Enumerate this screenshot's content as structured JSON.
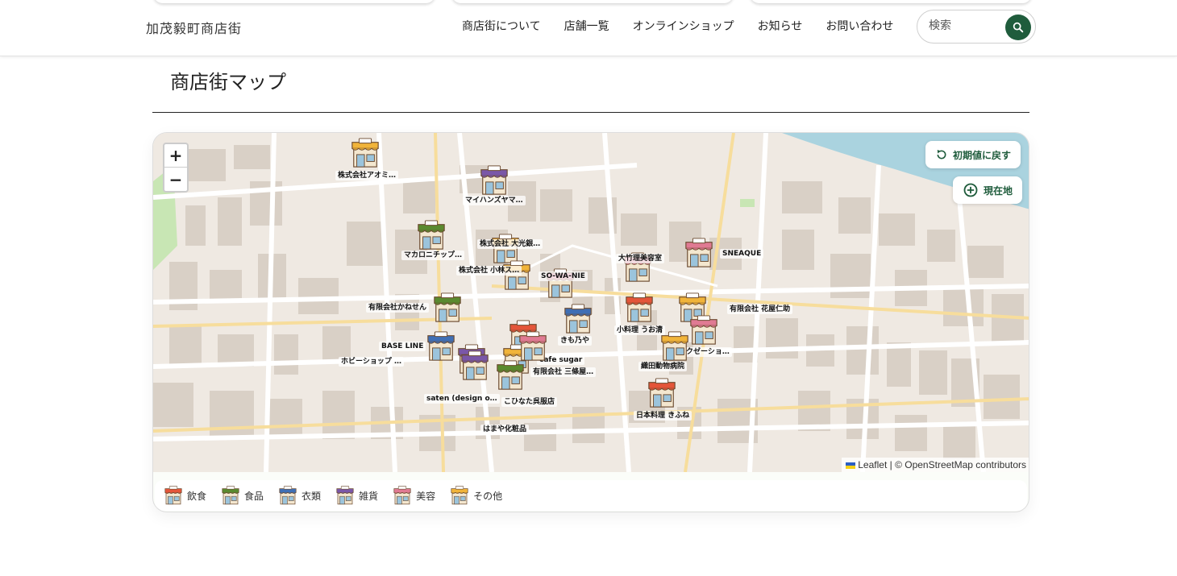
{
  "header": {
    "logo": "加茂毅町商店街",
    "nav": [
      "商店街について",
      "店舗一覧",
      "オンラインショップ",
      "お知らせ",
      "お問い合わせ"
    ],
    "search_placeholder": "検索"
  },
  "page_title": "商店街マップ",
  "map": {
    "reset_label": "初期値に戻す",
    "location_label": "現在地",
    "zoom_in": "+",
    "zoom_out": "−",
    "attribution_leaflet": "Leaflet",
    "attribution_osm": "| © OpenStreetMap contributors",
    "pins": [
      {
        "label": "株式会社アオミ…",
        "category": "other"
      },
      {
        "label": "マイハンズヤマ…",
        "category": "goods"
      },
      {
        "label": "マカロニチップ…",
        "category": "food"
      },
      {
        "label": "株式会社 大光銀…",
        "category": "other"
      },
      {
        "label": "株式会社 小林ス…",
        "category": "other"
      },
      {
        "label": "SO-WA-NIE",
        "category": "beauty"
      },
      {
        "label": "大竹理美容室",
        "category": "beauty"
      },
      {
        "label": "SNEAQUE",
        "category": "beauty"
      },
      {
        "label": "有限会社かねせん",
        "category": "food"
      },
      {
        "label": "有限会社 花屋仁助",
        "category": "other"
      },
      {
        "label": "小料理 うお清",
        "category": "dining"
      },
      {
        "label": "きも乃や",
        "category": "clothing"
      },
      {
        "label": "リラクゼーショ…",
        "category": "beauty"
      },
      {
        "label": "BASE LINE",
        "category": "clothing"
      },
      {
        "label": "ホビーショップ …",
        "category": "goods"
      },
      {
        "label": "cafe sugar",
        "category": "dining"
      },
      {
        "label": "有限会社 三條屋…",
        "category": "other"
      },
      {
        "label": "織田動物病院",
        "category": "other"
      },
      {
        "label": "saten (design o…",
        "category": "goods"
      },
      {
        "label": "こひなた呉服店",
        "category": "food"
      },
      {
        "label": "日本料理 きふね",
        "category": "dining"
      },
      {
        "label": "はまや化粧品",
        "category": "beauty"
      }
    ]
  },
  "legend": [
    {
      "label": "飲食",
      "color": "#e4553a"
    },
    {
      "label": "食品",
      "color": "#5a8a2f"
    },
    {
      "label": "衣類",
      "color": "#3f6fb5"
    },
    {
      "label": "雑貨",
      "color": "#7a57a8"
    },
    {
      "label": "美容",
      "color": "#e07a93"
    },
    {
      "label": "その他",
      "color": "#f1b43a"
    }
  ]
}
